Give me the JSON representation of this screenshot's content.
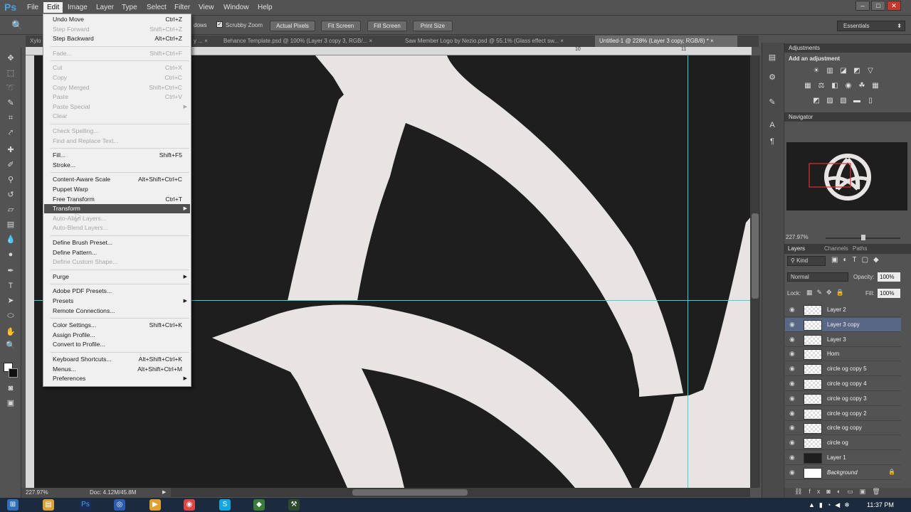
{
  "app": {
    "logo": "Ps"
  },
  "menubar": [
    "File",
    "Edit",
    "Image",
    "Layer",
    "Type",
    "Select",
    "Filter",
    "View",
    "Window",
    "Help"
  ],
  "window_controls": [
    "–",
    "□",
    "✕"
  ],
  "options": {
    "windows_label": "dows",
    "scrubby_zoom": "Scrubby Zoom",
    "buttons": [
      "Actual Pixels",
      "Fit Screen",
      "Fill Screen",
      "Print Size"
    ],
    "workspace": "Essentials"
  },
  "tabs": [
    {
      "label": "Xylo",
      "active": false
    },
    {
      "label": "y ...  ×",
      "active": false
    },
    {
      "label": "Behance Template.psd @ 100% (Layer 3 copy 3, RGB/...  ×",
      "active": false
    },
    {
      "label": "Saw Member Logo by Nezio.psd @ 55.1% (Glass effect sw...  ×",
      "active": false
    },
    {
      "label": "Untitled-1 @ 228% (Layer 3 copy, RGB/8) *  ×",
      "active": true
    }
  ],
  "ruler_numbers": [
    "10",
    "11"
  ],
  "status": {
    "zoom": "227.97%",
    "doc": "Doc: 4.12M/45.8M"
  },
  "edit_menu": [
    {
      "label": "Undo Move",
      "shortcut": "Ctrl+Z",
      "disabled": false
    },
    {
      "label": "Step Forward",
      "shortcut": "Shift+Ctrl+Z",
      "disabled": true
    },
    {
      "label": "Step Backward",
      "shortcut": "Alt+Ctrl+Z",
      "disabled": false
    },
    {
      "sep": true
    },
    {
      "label": "Fade...",
      "shortcut": "Shift+Ctrl+F",
      "disabled": true
    },
    {
      "sep": true
    },
    {
      "label": "Cut",
      "shortcut": "Ctrl+X",
      "disabled": true
    },
    {
      "label": "Copy",
      "shortcut": "Ctrl+C",
      "disabled": true
    },
    {
      "label": "Copy Merged",
      "shortcut": "Shift+Ctrl+C",
      "disabled": true
    },
    {
      "label": "Paste",
      "shortcut": "Ctrl+V",
      "disabled": true
    },
    {
      "label": "Paste Special",
      "shortcut": "",
      "disabled": true,
      "submenu": true
    },
    {
      "label": "Clear",
      "shortcut": "",
      "disabled": true
    },
    {
      "sep": true
    },
    {
      "label": "Check Spelling...",
      "shortcut": "",
      "disabled": true
    },
    {
      "label": "Find and Replace Text...",
      "shortcut": "",
      "disabled": true
    },
    {
      "sep": true
    },
    {
      "label": "Fill...",
      "shortcut": "Shift+F5",
      "disabled": false
    },
    {
      "label": "Stroke...",
      "shortcut": "",
      "disabled": false
    },
    {
      "sep": true
    },
    {
      "label": "Content-Aware Scale",
      "shortcut": "Alt+Shift+Ctrl+C",
      "disabled": false
    },
    {
      "label": "Puppet Warp",
      "shortcut": "",
      "disabled": false
    },
    {
      "label": "Free Transform",
      "shortcut": "Ctrl+T",
      "disabled": false
    },
    {
      "label": "Transform",
      "shortcut": "",
      "disabled": false,
      "submenu": true,
      "highlight": true
    },
    {
      "label": "Auto-Align Layers...",
      "shortcut": "",
      "disabled": true
    },
    {
      "label": "Auto-Blend Layers...",
      "shortcut": "",
      "disabled": true
    },
    {
      "sep": true
    },
    {
      "label": "Define Brush Preset...",
      "shortcut": "",
      "disabled": false
    },
    {
      "label": "Define Pattern...",
      "shortcut": "",
      "disabled": false
    },
    {
      "label": "Define Custom Shape...",
      "shortcut": "",
      "disabled": true
    },
    {
      "sep": true
    },
    {
      "label": "Purge",
      "shortcut": "",
      "disabled": false,
      "submenu": true
    },
    {
      "sep": true
    },
    {
      "label": "Adobe PDF Presets...",
      "shortcut": "",
      "disabled": false
    },
    {
      "label": "Presets",
      "shortcut": "",
      "disabled": false,
      "submenu": true
    },
    {
      "label": "Remote Connections...",
      "shortcut": "",
      "disabled": false
    },
    {
      "sep": true
    },
    {
      "label": "Color Settings...",
      "shortcut": "Shift+Ctrl+K",
      "disabled": false
    },
    {
      "label": "Assign Profile...",
      "shortcut": "",
      "disabled": false
    },
    {
      "label": "Convert to Profile...",
      "shortcut": "",
      "disabled": false
    },
    {
      "sep": true
    },
    {
      "label": "Keyboard Shortcuts...",
      "shortcut": "Alt+Shift+Ctrl+K",
      "disabled": false
    },
    {
      "label": "Menus...",
      "shortcut": "Alt+Shift+Ctrl+M",
      "disabled": false
    },
    {
      "label": "Preferences",
      "shortcut": "",
      "disabled": false,
      "submenu": true
    }
  ],
  "adjustments": {
    "title": "Adjustments",
    "subtitle": "Add an adjustment"
  },
  "navigator": {
    "title": "Navigator",
    "zoom": "227.97%"
  },
  "layers_panel": {
    "tabs": [
      "Layers",
      "Channels",
      "Paths"
    ],
    "kind": "Kind",
    "blend": "Normal",
    "opacity_label": "Opacity:",
    "opacity": "100%",
    "lock_label": "Lock:",
    "fill_label": "Fill:",
    "fill": "100%",
    "layers": [
      {
        "name": "Layer 2",
        "selected": false
      },
      {
        "name": "Layer 3 copy",
        "selected": true
      },
      {
        "name": "Layer 3",
        "selected": false
      },
      {
        "name": "Horn",
        "selected": false
      },
      {
        "name": "circle og copy 5",
        "selected": false
      },
      {
        "name": "circle og copy 4",
        "selected": false
      },
      {
        "name": "circle og copy 3",
        "selected": false
      },
      {
        "name": "circle og copy 2",
        "selected": false
      },
      {
        "name": "circle og copy",
        "selected": false
      },
      {
        "name": "circle og",
        "selected": false
      },
      {
        "name": "Layer 1",
        "selected": false
      },
      {
        "name": "Background",
        "selected": false
      }
    ]
  },
  "clock": "11:37 PM"
}
